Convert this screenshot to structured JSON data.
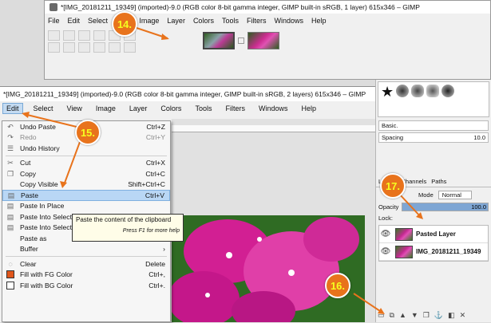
{
  "back_window": {
    "title": "*[IMG_20181211_19349] (imported)-9.0 (RGB color 8-bit gamma integer, GIMP built-in sRGB, 1 layer) 615x346 – GIMP",
    "menus": [
      "File",
      "Edit",
      "Select",
      "View",
      "Image",
      "Layer",
      "Colors",
      "Tools",
      "Filters",
      "Windows",
      "Help"
    ]
  },
  "front_window": {
    "title": "*[IMG_20181211_19349] (imported)-9.0 (RGB color 8-bit gamma integer, GIMP built-in sRGB, 2 layers) 615x346 – GIMP",
    "menus": [
      "Edit",
      "Select",
      "View",
      "Image",
      "Layer",
      "Colors",
      "Tools",
      "Filters",
      "Windows",
      "Help"
    ]
  },
  "edit_menu": {
    "items": [
      {
        "label": "Undo Paste",
        "shortcut": "Ctrl+Z",
        "icon": "undo-icon"
      },
      {
        "label": "Redo",
        "shortcut": "Ctrl+Y",
        "icon": "redo-icon",
        "disabled": true
      },
      {
        "label": "Undo History",
        "shortcut": "",
        "icon": "history-icon"
      },
      {
        "sep": true
      },
      {
        "label": "Cut",
        "shortcut": "Ctrl+X",
        "icon": "cut-icon"
      },
      {
        "label": "Copy",
        "shortcut": "Ctrl+C",
        "icon": "copy-icon"
      },
      {
        "label": "Copy Visible",
        "shortcut": "Shift+Ctrl+C",
        "icon": ""
      },
      {
        "label": "Paste",
        "shortcut": "Ctrl+V",
        "icon": "paste-icon",
        "highlight": true
      },
      {
        "label": "Paste In Place",
        "shortcut": "",
        "icon": "paste-icon"
      },
      {
        "label": "Paste Into Selection",
        "shortcut": "",
        "icon": "paste-icon"
      },
      {
        "label": "Paste Into Selection In Place",
        "shortcut": "",
        "icon": "paste-icon"
      },
      {
        "label": "Paste as",
        "shortcut": "›",
        "icon": ""
      },
      {
        "label": "Buffer",
        "shortcut": "›",
        "icon": ""
      },
      {
        "sep": true
      },
      {
        "label": "Clear",
        "shortcut": "Delete",
        "icon": "clear-icon"
      },
      {
        "label": "Fill with FG Color",
        "shortcut": "Ctrl+,",
        "icon": "fg-swatch"
      },
      {
        "label": "Fill with BG Color",
        "shortcut": "Ctrl+.",
        "icon": "bg-swatch"
      }
    ]
  },
  "tooltip": {
    "text": "Paste the content of the clipboard",
    "hint": "Press F1 for more help"
  },
  "dock": {
    "brush_preset": "Basic.",
    "spacing_label": "Spacing",
    "spacing_value": "10.0",
    "tabs": [
      "Layers",
      "Channels",
      "Paths"
    ],
    "mode_label": "Mode",
    "mode_value": "Normal",
    "opacity_label": "Opacity",
    "opacity_value": "100.0",
    "lock_label": "Lock:",
    "layers": [
      {
        "name": "Pasted Layer"
      },
      {
        "name": "IMG_20181211_19349"
      }
    ]
  },
  "badges": [
    "14.",
    "15.",
    "16.",
    "17."
  ],
  "colors": {
    "badge": "#e8731c",
    "badge_text": "#f5ff20",
    "highlight": "#b9d7f5"
  }
}
